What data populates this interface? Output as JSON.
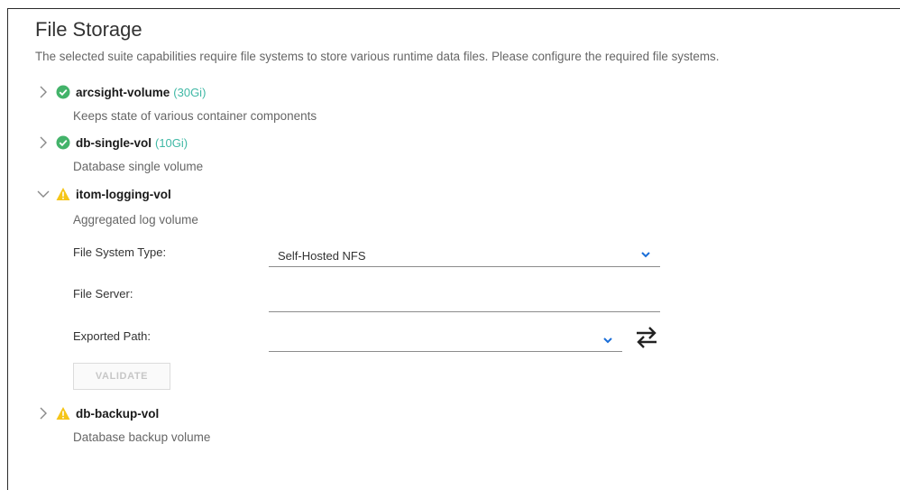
{
  "page": {
    "title": "File Storage",
    "description": "The selected suite capabilities require file systems to store various runtime data files. Please configure the required file systems."
  },
  "colors": {
    "ok": "#43b36a",
    "warning": "#f5c518",
    "size_text": "#3fb8a5",
    "caret": "#1a6ed8"
  },
  "volumes": [
    {
      "name": "arcsight-volume",
      "size": "(30Gi)",
      "description": "Keeps state of various container components",
      "status_icon": "check-circle-icon",
      "expanded": false
    },
    {
      "name": "db-single-vol",
      "size": "(10Gi)",
      "description": "Database single volume",
      "status_icon": "check-circle-icon",
      "expanded": false
    },
    {
      "name": "itom-logging-vol",
      "size": "",
      "description": "Aggregated log volume",
      "status_icon": "warning-triangle-icon",
      "expanded": true
    },
    {
      "name": "db-backup-vol",
      "size": "",
      "description": "Database backup volume",
      "status_icon": "warning-triangle-icon",
      "expanded": false
    }
  ],
  "form": {
    "file_system_type_label": "File System Type:",
    "file_system_type_value": "Self-Hosted NFS",
    "file_server_label": "File Server:",
    "file_server_value": "",
    "exported_path_label": "Exported Path:",
    "exported_path_value": "",
    "validate_label": "VALIDATE"
  }
}
